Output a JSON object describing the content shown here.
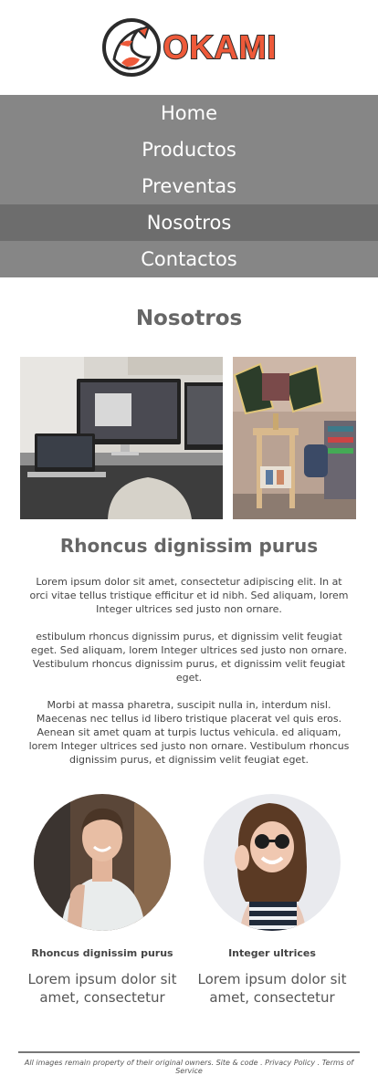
{
  "brand": {
    "name": "OKAMI",
    "accent": "#ee5a3a",
    "outline": "#2b2b2b"
  },
  "nav": {
    "items": [
      {
        "label": "Home"
      },
      {
        "label": "Productos"
      },
      {
        "label": "Preventas"
      },
      {
        "label": "Nosotros"
      },
      {
        "label": "Contactos"
      }
    ],
    "active_index": 3,
    "bg": "#868686",
    "active_bg": "#6d6d6d"
  },
  "main": {
    "title": "Nosotros",
    "subtitle": "Rhoncus dignissim purus",
    "paragraphs": [
      "Lorem ipsum dolor sit amet, consectetur adipiscing elit. In at orci vitae tellus tristique efficitur et id nibh. Sed aliquam, lorem Integer ultrices sed justo non ornare.",
      "estibulum rhoncus dignissim purus, et dignissim velit feugiat eget. Sed aliquam, lorem Integer ultrices sed justo non ornare. Vestibulum rhoncus dignissim purus, et dignissim velit feugiat eget.",
      "Morbi at massa pharetra, suscipit nulla in, interdum nisl. Maecenas nec tellus id libero tristique placerat vel quis eros. Aenean sit amet quam at turpis luctus vehicula. ed aliquam, lorem Integer ultrices sed justo non ornare. Vestibulum rhoncus dignissim purus, et dignissim velit feugiat eget."
    ]
  },
  "profiles": [
    {
      "name": "Rhoncus dignissim purus",
      "text": "Lorem ipsum dolor sit amet, consectetur"
    },
    {
      "name": "Integer ultrices",
      "text": "Lorem ipsum dolor sit amet, consectetur"
    }
  ],
  "footer": {
    "text": "All images remain property of their original owners. Site & code . Privacy Policy . Terms of Service"
  }
}
